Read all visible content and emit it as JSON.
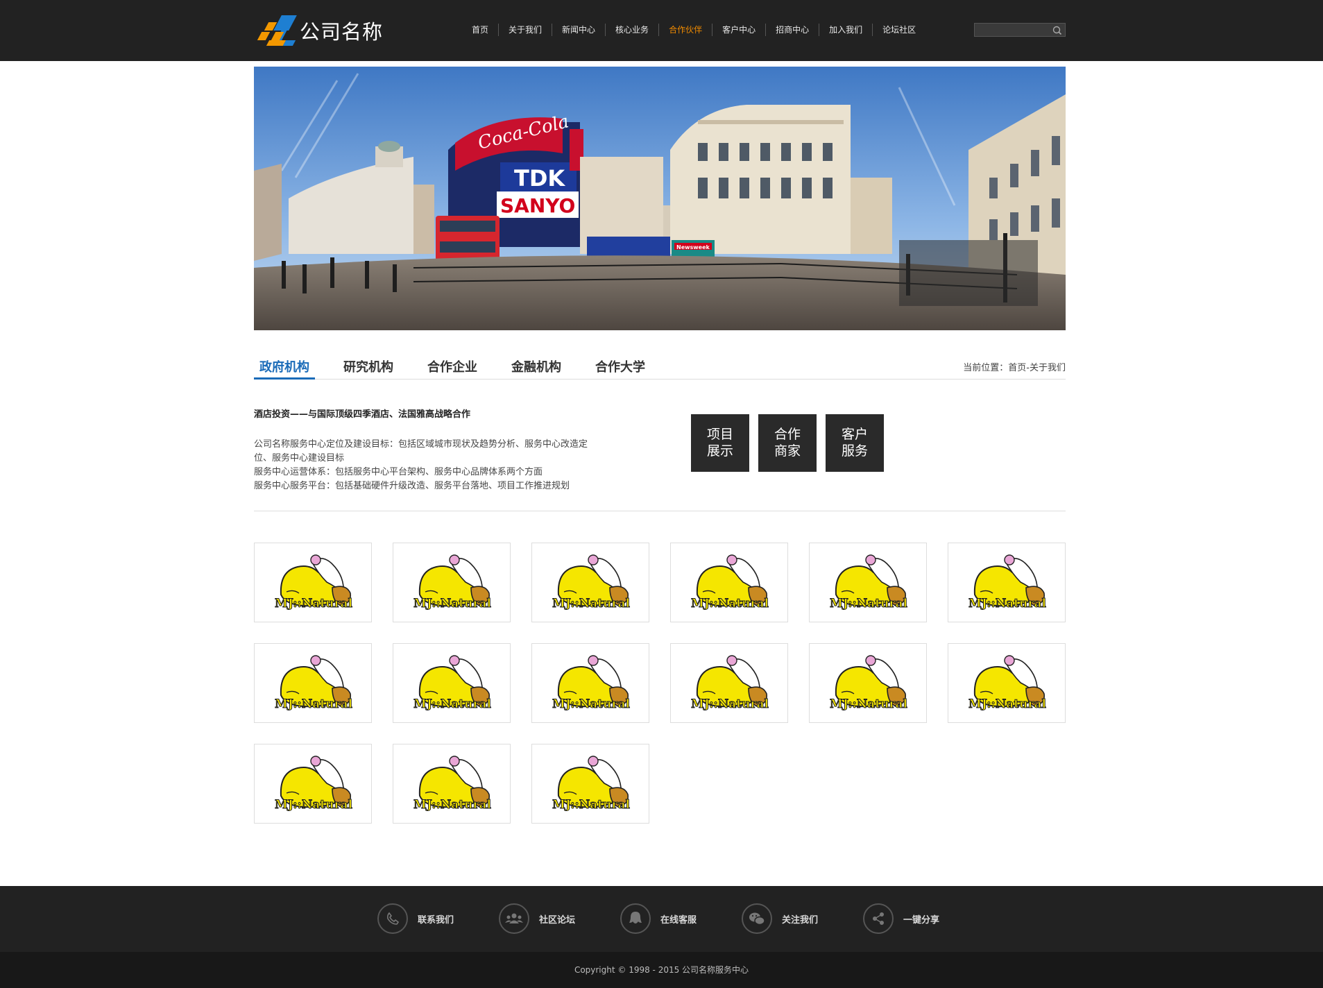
{
  "header": {
    "logo_text": "公司名称",
    "nav": [
      {
        "label": "首页"
      },
      {
        "label": "关于我们"
      },
      {
        "label": "新闻中心"
      },
      {
        "label": "核心业务"
      },
      {
        "label": "合作伙伴"
      },
      {
        "label": "客户中心"
      },
      {
        "label": "招商中心"
      },
      {
        "label": "加入我们"
      },
      {
        "label": "论坛社区"
      }
    ],
    "active_nav": "合作伙伴",
    "search_placeholder": "",
    "search_icon": "search-icon"
  },
  "banner": {
    "signs": {
      "cola": "Coca-Cola",
      "tdk": "TDK",
      "sanyo": "SANYO",
      "kiosk": "Newsweek"
    }
  },
  "tabs": {
    "items": [
      {
        "label": "政府机构"
      },
      {
        "label": "研究机构"
      },
      {
        "label": "合作企业"
      },
      {
        "label": "金融机构"
      },
      {
        "label": "合作大学"
      }
    ],
    "active": "政府机构",
    "breadcrumb": "当前位置：首页-关于我们"
  },
  "intro": {
    "title": "酒店投资——与国际顶级四季酒店、法国雅高战略合作",
    "lines": [
      "公司名称服务中心定位及建设目标：包括区域城市现状及趋势分析、服务中心改造定",
      "位、服务中心建设目标",
      "服务中心运营体系：包括服务中心平台架构、服务中心品牌体系两个方面",
      "服务中心服务平台：包括基础硬件升级改造、服务平台落地、项目工作推进规划"
    ]
  },
  "quick_links": [
    {
      "line1": "项目",
      "line2": "展示"
    },
    {
      "line1": "合作",
      "line2": "商家"
    },
    {
      "line1": "客户",
      "line2": "服务"
    }
  ],
  "partners": {
    "logo_text": "MJ::Natural",
    "count": 15
  },
  "footer": {
    "items": [
      {
        "label": "联系我们",
        "icon": "phone-icon"
      },
      {
        "label": "社区论坛",
        "icon": "community-icon"
      },
      {
        "label": "在线客服",
        "icon": "support-icon"
      },
      {
        "label": "关注我们",
        "icon": "wechat-icon"
      },
      {
        "label": "一键分享",
        "icon": "share-icon"
      }
    ],
    "copyright": "Copyright © 1998 - 2015 公司名称服务中心"
  },
  "colors": {
    "header_bg": "#222222",
    "nav_active": "#ef8a00",
    "tab_active": "#1a6bb8",
    "quick_bg": "#2a2a2a",
    "logo_orange": "#f39800",
    "logo_blue": "#1e7fd2"
  }
}
